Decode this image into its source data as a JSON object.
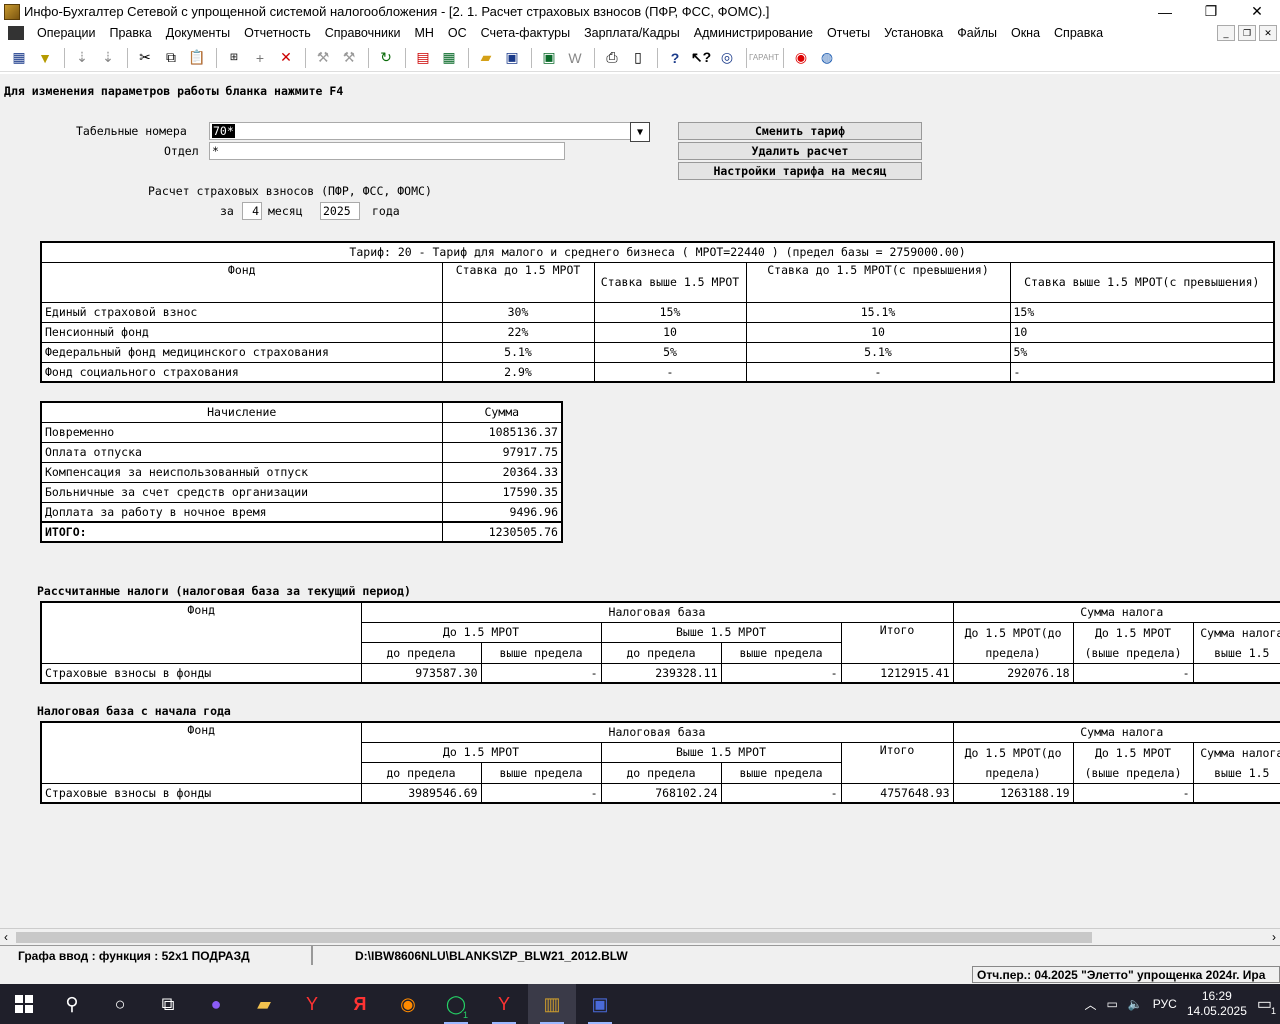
{
  "window": {
    "title": "Инфо-Бухгалтер Сетевой с упрощенной системой налогообложения - [2. 1. Расчет страховых взносов (ПФР, ФСС, ФОМС).]",
    "minimize": "—",
    "restore": "❐",
    "close": "✕"
  },
  "menu": [
    "Операции",
    "Правка",
    "Документы",
    "Отчетность",
    "Справочники",
    "МН",
    "ОС",
    "Счета-фактуры",
    "Зарплата/Кадры",
    "Администрирование",
    "Отчеты",
    "Установка",
    "Файлы",
    "Окна",
    "Справка"
  ],
  "toolbar_icons": [
    "grid-icon",
    "filter-icon",
    "sort-asc-icon",
    "sort-desc-icon",
    "cut-icon",
    "copy-icon",
    "paste-icon",
    "calc-icon",
    "add-icon",
    "delete-icon",
    "tool1-icon",
    "tool2-icon",
    "refresh-icon",
    "pdf-icon",
    "calculator-icon",
    "open-folder-icon",
    "save-icon",
    "excel-icon",
    "word-icon",
    "print-icon",
    "preview-icon",
    "help-icon",
    "whatis-icon",
    "compass-icon",
    "garant-icon",
    "lifebuoy-icon",
    "globe-icon"
  ],
  "form": {
    "hint": "Для изменения параметров работы бланка нажмите F4",
    "tab_label": "Табельные номера",
    "tab_value": "70*",
    "dept_label": "Отдел",
    "dept_value": "*",
    "calc_title": "Расчет страховых взносов (ПФР, ФСС, ФОМС)",
    "for_label": "за",
    "month_value": "4",
    "month_label": "месяц",
    "year_value": "2025",
    "year_label": "года",
    "btn_change_tariff": "Сменить тариф",
    "btn_delete_calc": "Удалить расчет",
    "btn_tariff_settings": "Настройки тарифа на месяц"
  },
  "tariff": {
    "title": "Тариф: 20 - Тариф для малого и среднего бизнеса ( МРОТ=22440 ) (предел базы = 2759000.00)",
    "headers": [
      "Фонд",
      "Ставка до 1.5 МРОТ",
      "Ставка выше 1.5 МРОТ",
      "Ставка до 1.5 МРОТ(с превышения)",
      "Ставка выше 1.5 МРОТ(с превышения)"
    ],
    "rows": [
      [
        "Единый страховой взнос",
        "30%",
        "15%",
        "15.1%",
        "15%"
      ],
      [
        "Пенсионный фонд",
        "22%",
        "10",
        "10",
        "10"
      ],
      [
        "Федеральный фонд медицинского страхования",
        "5.1%",
        "5%",
        "5.1%",
        "5%"
      ],
      [
        "Фонд социального страхования",
        "2.9%",
        "-",
        "-",
        "-"
      ]
    ]
  },
  "accruals": {
    "headers": [
      "Начисление",
      "Сумма"
    ],
    "rows": [
      [
        "Повременно",
        "1085136.37"
      ],
      [
        "Оплата отпуска",
        "97917.75"
      ],
      [
        "Компенсация за неиспользованный отпуск",
        "20364.33"
      ],
      [
        "Больничные за счет средств организации",
        "17590.35"
      ],
      [
        "Доплата за работу в ночное время",
        "9496.96"
      ]
    ],
    "total_label": "ИТОГО:",
    "total_value": "1230505.76"
  },
  "taxes_current": {
    "title": "Рассчитанные налоги (налоговая база за текущий период)",
    "h_fund": "Фонд",
    "h_base": "Налоговая база",
    "h_sum": "Сумма налога",
    "h_below": "До 1.5 МРОТ",
    "h_above": "Выше 1.5 МРОТ",
    "h_total": "Итого",
    "h_sum_below": "До 1.5 МРОТ(до предела)",
    "h_sum_below_over": "До 1.5 МРОТ (выше предела)",
    "h_sum_above": "Сумма налога выше 1.5",
    "h_to_limit": "до предела",
    "h_over_limit": "выше предела",
    "row": [
      "Страховые взносы в фонды",
      "973587.30",
      "-",
      "239328.11",
      "-",
      "1212915.41",
      "292076.18",
      "-",
      ""
    ]
  },
  "taxes_ytd": {
    "title": "Налоговая база с начала года",
    "row": [
      "Страховые взносы в фонды",
      "3989546.69",
      "-",
      "768102.24",
      "-",
      "4757648.93",
      "1263188.19",
      "-",
      ""
    ]
  },
  "status": {
    "mode": "Графа  ввод : функция : 52x1  ПОДРАЗД",
    "path": "D:\\IBW8606NLU\\BLANKS\\ZP_BLW21_2012.BLW",
    "period": "Отч.пер.: 04.2025  \"Элетто\" упрощенка 2024г.  Ира"
  },
  "taskbar": {
    "lang": "РУС",
    "time": "16:29",
    "date": "14.05.2025",
    "whatsapp_badge": "1",
    "notif_badge": "1"
  }
}
